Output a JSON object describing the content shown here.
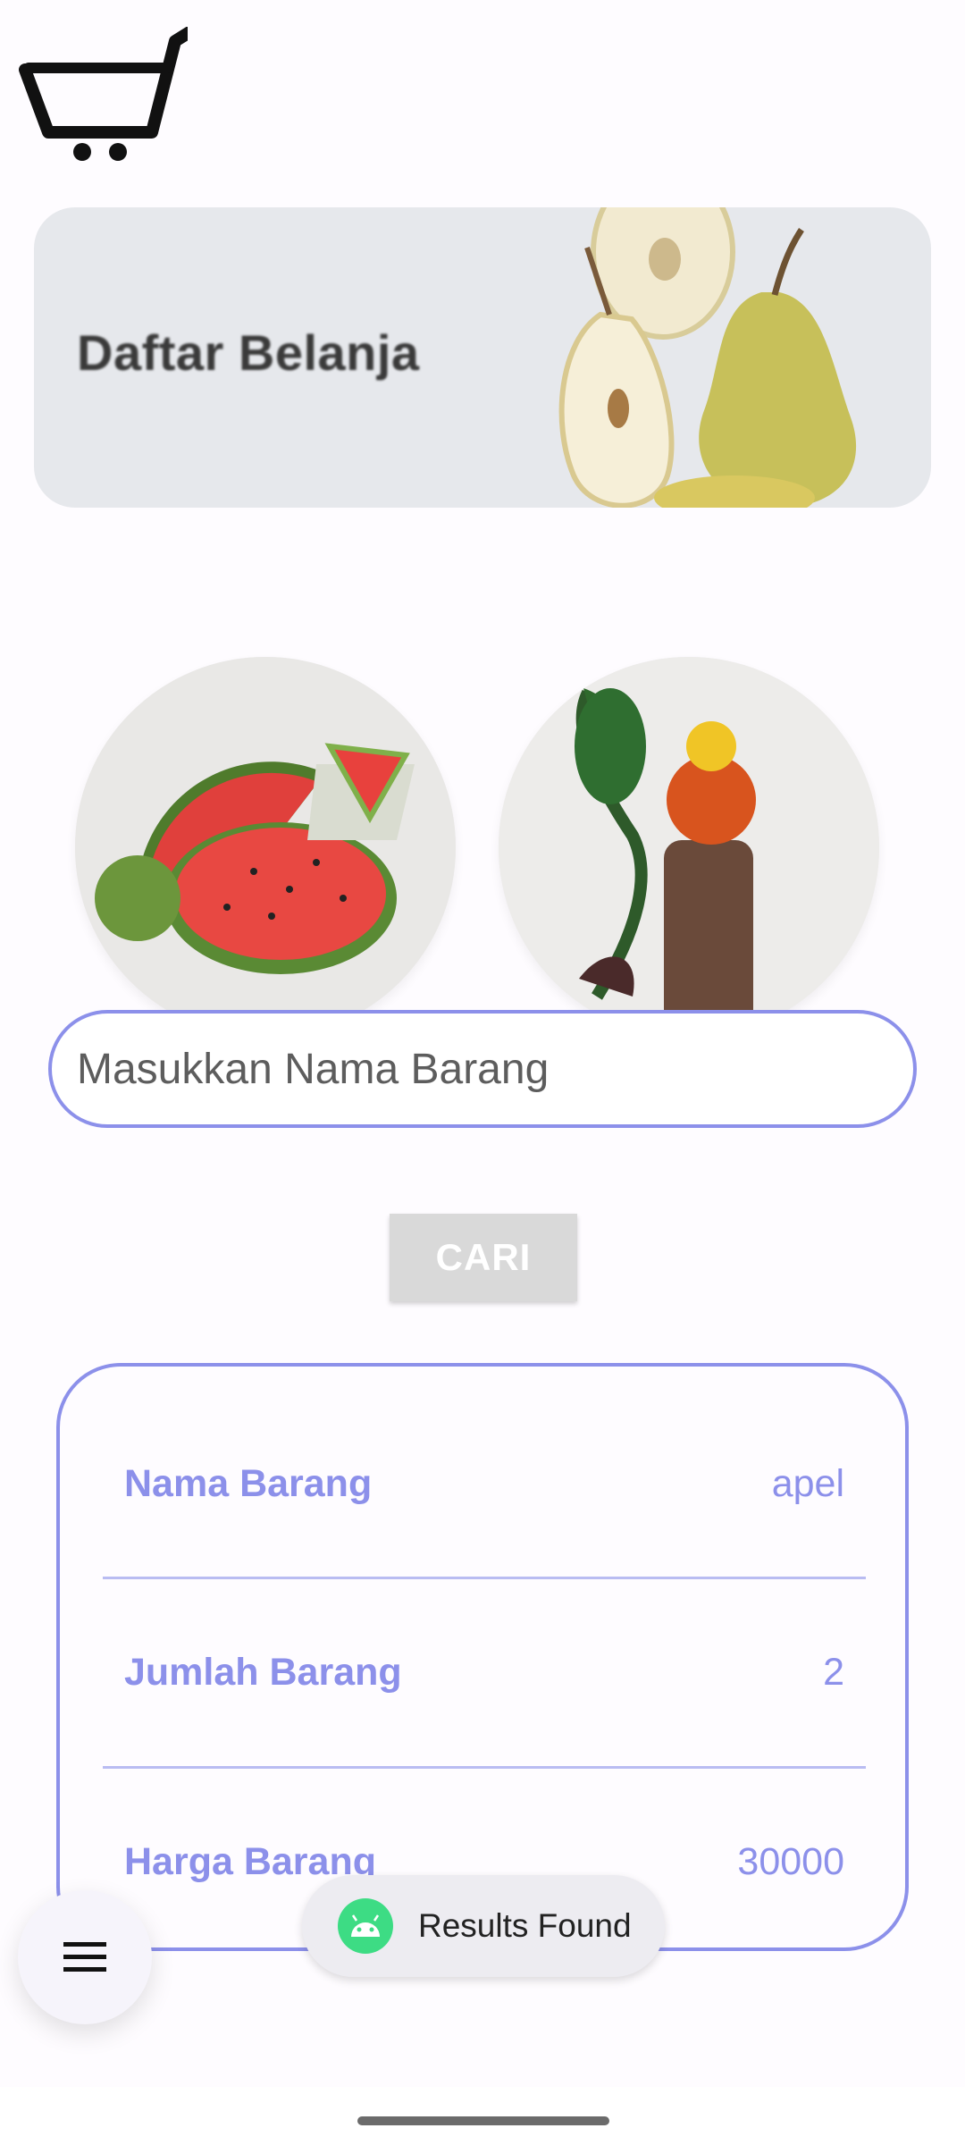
{
  "banner": {
    "title": "Daftar Belanja"
  },
  "search": {
    "placeholder": "Masukkan Nama Barang",
    "value": ""
  },
  "button": {
    "label": "CARI"
  },
  "result": {
    "rows": [
      {
        "label": "Nama Barang",
        "value": "apel"
      },
      {
        "label": "Jumlah Barang",
        "value": "2"
      },
      {
        "label": "Harga Barang",
        "value": "30000"
      }
    ]
  },
  "toast": {
    "text": "Results Found",
    "icon": "android-icon"
  },
  "icons": {
    "logo": "shopping-cart-icon",
    "fab": "menu-icon"
  },
  "colors": {
    "accent": "#8c90ea",
    "button_disabled": "#d9d9d9",
    "android_green": "#3ddc84"
  }
}
